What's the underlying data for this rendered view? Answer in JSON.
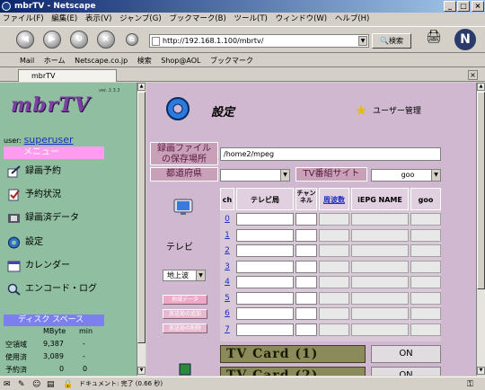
{
  "window": {
    "title": "mbrTV - Netscape"
  },
  "menu": [
    "ファイル(F)",
    "編集(E)",
    "表示(V)",
    "ジャンプ(G)",
    "ブックマーク(B)",
    "ツール(T)",
    "ウィンドウ(W)",
    "ヘルプ(H)"
  ],
  "nav": {
    "url": "http://192.168.1.100/mbrtv/",
    "search_label": "検索"
  },
  "personal_toolbar": [
    "Mail",
    "ホーム",
    "Netscape.co.jp",
    "検索",
    "Shop@AOL",
    "ブックマーク"
  ],
  "tab": {
    "label": "mbrTV"
  },
  "sidebar": {
    "logo": "mbrTV",
    "version": "ver. 2.3.3",
    "user_label": "user:",
    "user_name": "superuser",
    "menu_header": "メニュー",
    "items": [
      {
        "label": "録画予約",
        "icon": "pen-icon"
      },
      {
        "label": "予約状況",
        "icon": "document-check-icon"
      },
      {
        "label": "録画済データ",
        "icon": "film-icon"
      },
      {
        "label": "設定",
        "icon": "gear-icon"
      },
      {
        "label": "カレンダー",
        "icon": "calendar-icon"
      },
      {
        "label": "エンコード・ログ",
        "icon": "magnifier-icon"
      }
    ],
    "disk": {
      "header": "ディスク スペース",
      "unit_col": "MByte",
      "min_col": "min",
      "rows": [
        {
          "label": "空領域",
          "mbyte": "9,387",
          "min": "-"
        },
        {
          "label": "使用済",
          "mbyte": "3,089",
          "min": "-"
        },
        {
          "label": "予約済",
          "mbyte": "0",
          "min": "0"
        }
      ]
    }
  },
  "main": {
    "title": "設定",
    "user_mgmt": "ユーザー管理",
    "rec_dir_label_1": "録画ファイル",
    "rec_dir_label_2": "の保存場所",
    "rec_dir_value": "/home2/mpeg",
    "prefecture_label": "都道府県",
    "prefecture_value": "",
    "tvsite_label": "TV番組サイト",
    "tvsite_value": "goo",
    "tv_label": "テレビ",
    "band_value": "地上波",
    "side_buttons": [
      "地域データ",
      "放送局の追加",
      "放送局の削除"
    ],
    "channel_table": {
      "headers": [
        "ch",
        "テレビ局",
        "チャンネル",
        "周波数",
        "iEPG NAME",
        "goo"
      ],
      "rows": [
        "0",
        "1",
        "2",
        "3",
        "4",
        "5",
        "6",
        "7"
      ]
    },
    "cards": [
      {
        "label": "TV Card (1)",
        "button": "ON"
      },
      {
        "label": "TV Card (2)",
        "button": "ON"
      }
    ]
  },
  "status": {
    "text": "ドキュメント: 完了 (0.66 秒)"
  },
  "colors": {
    "sidebar_bg": "#8fbfa0",
    "main_bg": "#d0b8d0",
    "menu_header": "#ff9cf0",
    "disk_header": "#7b7ff0"
  }
}
